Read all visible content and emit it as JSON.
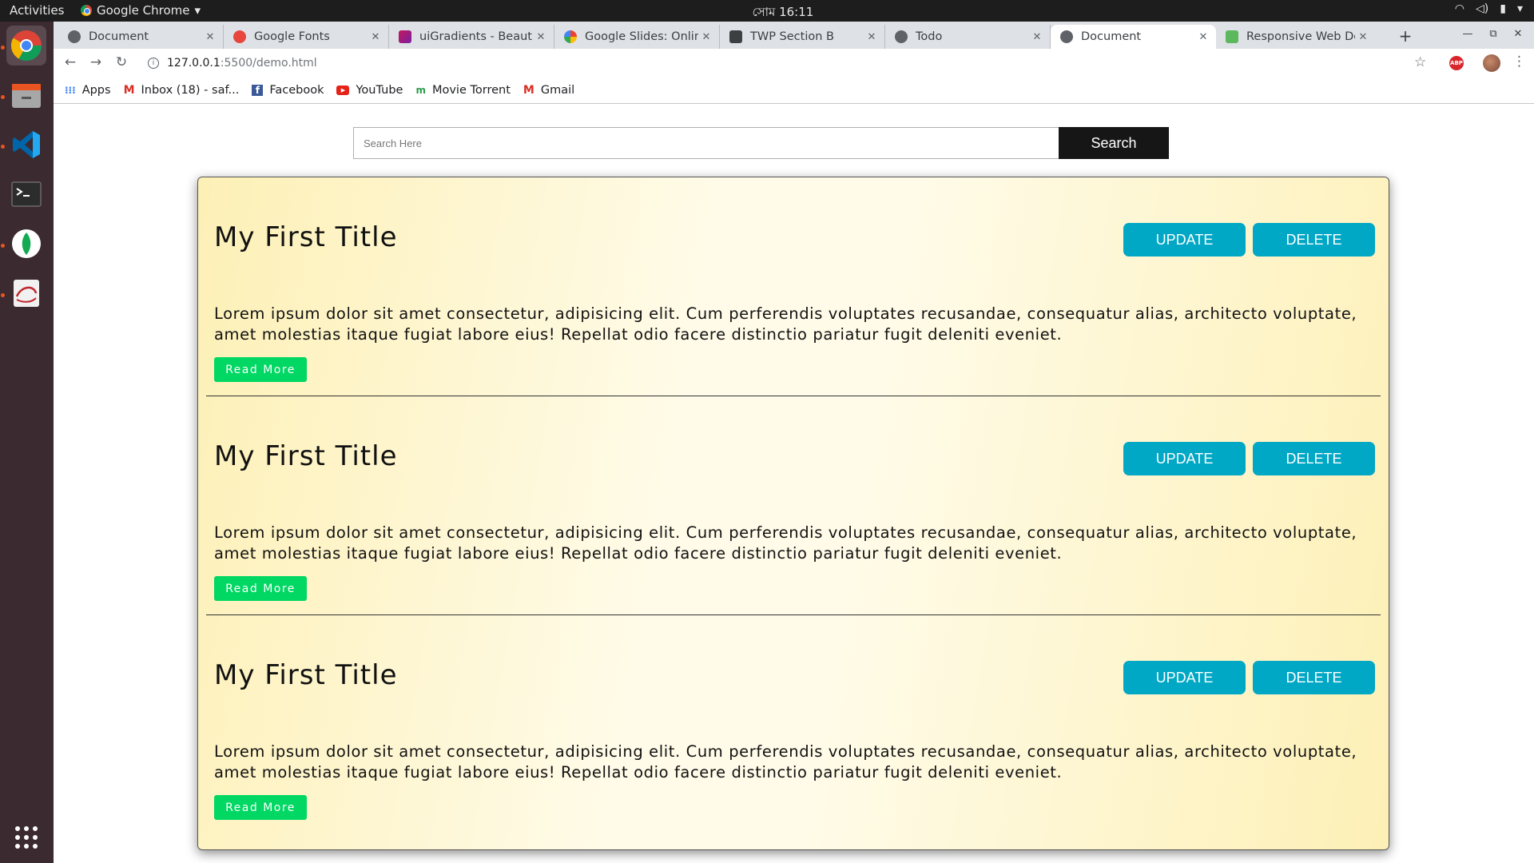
{
  "system_bar": {
    "activities": "Activities",
    "app_name": "Google Chrome",
    "clock": "সোম 16:11"
  },
  "dock": {
    "items": [
      "chrome-icon",
      "files-icon",
      "vscode-icon",
      "terminal-icon",
      "mongodb-compass-icon",
      "text-editor-icon"
    ],
    "show_apps": "apps-grid-icon"
  },
  "tabs": [
    {
      "title": "Document",
      "favicon": "globe-icon"
    },
    {
      "title": "Google Fonts",
      "favicon": "google-fonts-icon"
    },
    {
      "title": "uiGradients - Beautif",
      "favicon": "uigradients-icon"
    },
    {
      "title": "Google Slides: Online",
      "favicon": "google-icon"
    },
    {
      "title": "TWP Section B",
      "favicon": "classroom-icon"
    },
    {
      "title": "Todo",
      "favicon": "globe-icon"
    },
    {
      "title": "Document",
      "favicon": "globe-icon",
      "active": true
    },
    {
      "title": "Responsive Web Des",
      "favicon": "freecodecamp-icon"
    }
  ],
  "address_bar": {
    "host": "127.0.0.1",
    "path": ":5500/demo.html"
  },
  "bookmarks": [
    {
      "label": "Apps",
      "icon": "apps-grid-icon"
    },
    {
      "label": "Inbox (18) - saf...",
      "icon": "gmail-icon"
    },
    {
      "label": "Facebook",
      "icon": "facebook-icon"
    },
    {
      "label": "YouTube",
      "icon": "youtube-icon"
    },
    {
      "label": "Movie Torrent",
      "icon": "torrent-icon"
    },
    {
      "label": "Gmail",
      "icon": "gmail-icon"
    }
  ],
  "search": {
    "placeholder": "Search Here",
    "button_label": "Search"
  },
  "posts": [
    {
      "title": "My First Title",
      "update_label": "UPDATE",
      "delete_label": "DELETE",
      "body": "Lorem ipsum dolor sit amet consectetur, adipisicing elit. Cum perferendis voluptates recusandae, consequatur alias, architecto voluptate, amet molestias itaque fugiat labore eius! Repellat odio facere distinctio pariatur fugit deleniti eveniet.",
      "read_more_label": "Read More"
    },
    {
      "title": "My First Title",
      "update_label": "UPDATE",
      "delete_label": "DELETE",
      "body": "Lorem ipsum dolor sit amet consectetur, adipisicing elit. Cum perferendis voluptates recusandae, consequatur alias, architecto voluptate, amet molestias itaque fugiat labore eius! Repellat odio facere distinctio pariatur fugit deleniti eveniet.",
      "read_more_label": "Read More"
    },
    {
      "title": "My First Title",
      "update_label": "UPDATE",
      "delete_label": "DELETE",
      "body": "Lorem ipsum dolor sit amet consectetur, adipisicing elit. Cum perferendis voluptates recusandae, consequatur alias, architecto voluptate, amet molestias itaque fugiat labore eius! Repellat odio facere distinctio pariatur fugit deleniti eveniet.",
      "read_more_label": "Read More"
    }
  ],
  "colors": {
    "accent_button": "#00a8c6",
    "read_more": "#00d863",
    "search_button": "#161616",
    "card_gradient_edge": "#fdf0b6",
    "card_gradient_center": "#fffbe8"
  }
}
